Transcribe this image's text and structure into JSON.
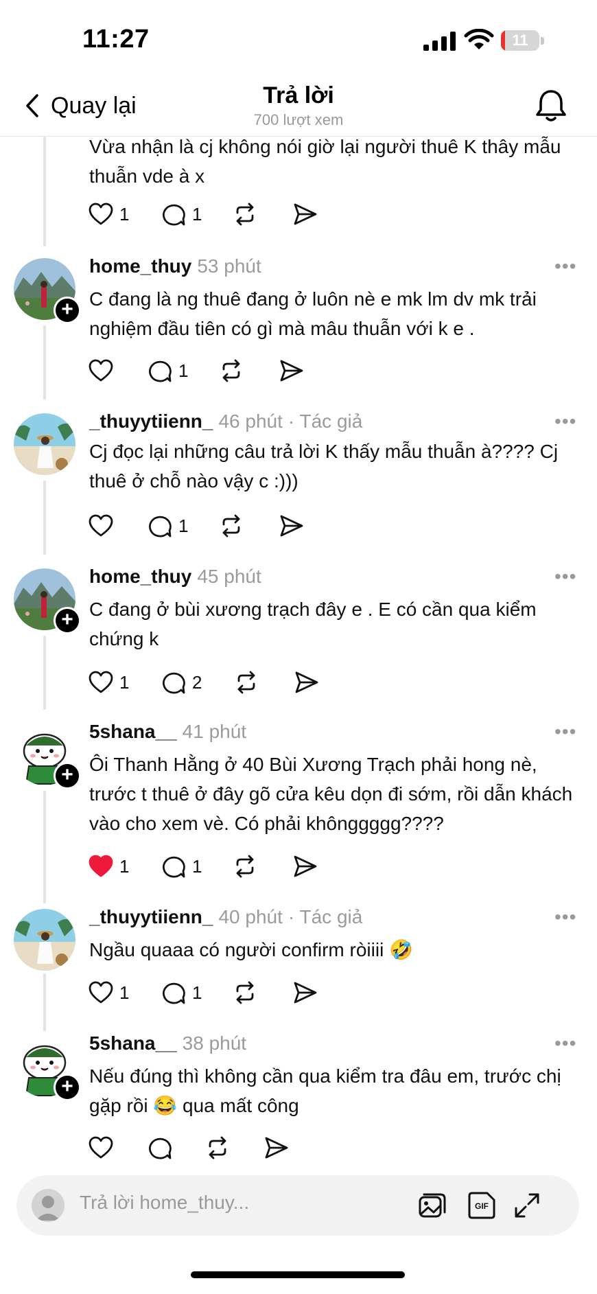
{
  "status_bar": {
    "time": "11:27",
    "battery_level": "11",
    "battery_fraction": 0.11,
    "battery_color": "#e8322c"
  },
  "nav": {
    "back_label": "Quay lại",
    "title": "Trả lời",
    "subtitle": "700 lượt xem"
  },
  "top_partial": {
    "text": "Vừa nhận là cj không  nói giờ lại người thuê K thây mẫu thuẫn vde à x",
    "likes": "1",
    "replies": "1"
  },
  "posts": [
    {
      "user": "home_thuy",
      "time": "53 phút",
      "author_tag": "",
      "text": "C đang là ng thuê đang ở luôn nè e mk lm dv mk trải nghiệm đầu tiên có gì mà mâu thuẫn với k e .",
      "likes": "",
      "replies": "1",
      "liked": false
    },
    {
      "user": "_thuyytiienn_",
      "time": "46 phút",
      "author_tag": "· Tác giả",
      "text": "Cj đọc lại những câu trả lời K thấy mẫu thuẫn à???? Cj thuê ở chỗ nào vậy c :)))",
      "likes": "",
      "replies": "1",
      "liked": false
    },
    {
      "user": "home_thuy",
      "time": "45 phút",
      "author_tag": "",
      "text": "C đang ở bùi xương trạch đây e . E có cần qua kiểm chứng k",
      "likes": "1",
      "replies": "2",
      "liked": false
    },
    {
      "user": "5shana__",
      "time": "41 phút",
      "author_tag": "",
      "text": "Ôi Thanh Hằng ở 40 Bùi Xương Trạch phải hong nè, trước t thuê ở đây gõ cửa kêu dọn đi sớm, rồi dẫn khách vào cho xem vè. Có phải khônggggg????",
      "likes": "1",
      "replies": "1",
      "liked": true
    },
    {
      "user": "_thuyytiienn_",
      "time": "40 phút",
      "author_tag": "· Tác giả",
      "text": "Ngầu quaaa có người confirm ròiiii 🤣",
      "likes": "1",
      "replies": "1",
      "liked": false
    },
    {
      "user": "5shana__",
      "time": "38 phút",
      "author_tag": "",
      "text": "Nếu đúng thì không cần qua kiểm tra đâu em, trước chị gặp rồi 😂 qua mất công",
      "likes": "",
      "replies": "",
      "liked": false
    }
  ],
  "reply_bar": {
    "placeholder": "Trả lời home_thuy..."
  },
  "colors": {
    "like_active": "#ed1a3b",
    "meta": "#9b9b9b"
  }
}
